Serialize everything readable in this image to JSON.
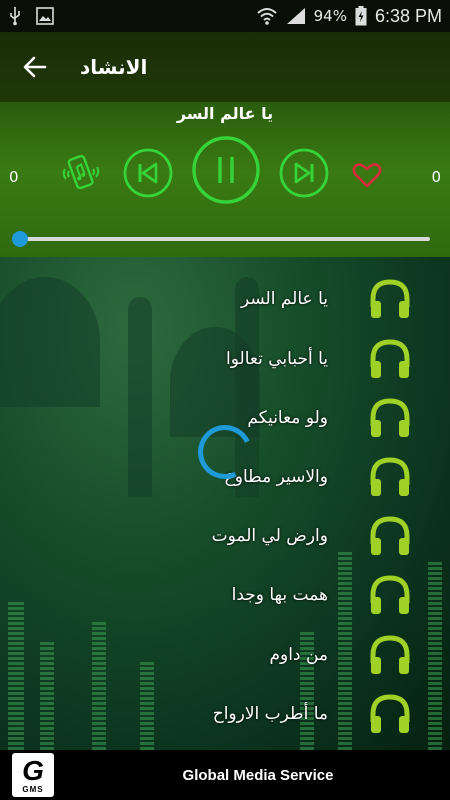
{
  "status_bar": {
    "battery_percent": "94%",
    "time": "6:38 PM"
  },
  "toolbar": {
    "title": "الانشاد"
  },
  "player": {
    "track_title": "يا عالم السر",
    "elapsed_count": "0",
    "total_count": "0",
    "progress": 0
  },
  "songs": [
    {
      "title": "يا عالم السر"
    },
    {
      "title": "يا أحبابي تعالوا"
    },
    {
      "title": "ولو معانيكم"
    },
    {
      "title": "والاسير مطاوع"
    },
    {
      "title": "وارض لي الموت"
    },
    {
      "title": "همت بها وجدا"
    },
    {
      "title": "من داوم"
    },
    {
      "title": "ما أطرب الارواح"
    }
  ],
  "footer": {
    "company": "Global Media Service",
    "logo_text": "GMS"
  },
  "colors": {
    "accent_green": "#35d43a",
    "headphone_green": "#9fd126",
    "heart_red": "#e0263a",
    "seek_blue": "#1e9ad8"
  },
  "icons": [
    "usb-icon",
    "image-icon",
    "wifi-icon",
    "signal-icon",
    "battery-icon",
    "back-arrow-icon",
    "phone-shake-icon",
    "previous-icon",
    "pause-icon",
    "next-icon",
    "heart-icon",
    "headphones-icon"
  ]
}
